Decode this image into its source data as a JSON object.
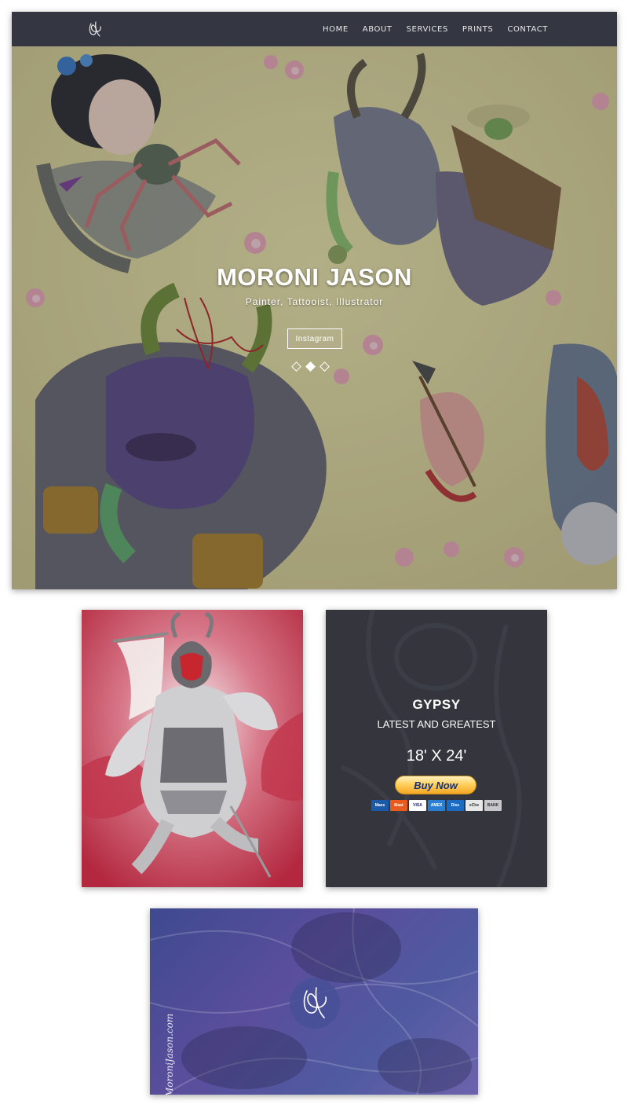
{
  "site": {
    "nav": {
      "logo_icon": "signature-logo-icon",
      "links": [
        "HOME",
        "ABOUT",
        "SERVICES",
        "PRINTS",
        "CONTACT"
      ]
    },
    "hero": {
      "title": "MORONI JASON",
      "subtitle": "Painter, Tattooist, Illustrator",
      "button_label": "Instagram",
      "slide_count": 3,
      "active_slide": 2
    }
  },
  "product": {
    "title": "GYPSY",
    "subtitle": "LATEST AND GREATEST",
    "size": "18' X 24'",
    "buy_label": "Buy Now",
    "payment_cards": [
      "Maestro",
      "MasterCard",
      "VISA",
      "AMEX",
      "Discover",
      "eCheck",
      "BANK"
    ]
  },
  "business_card": {
    "signature_text": "MoroniJason.com"
  },
  "colors": {
    "navbar": "#343741",
    "product_card_bg": "#34353d",
    "business_card_bg": "#4f5aa0",
    "print_red": "#c0344a",
    "paypal_yellow": "#ffd15e",
    "paypal_blue": "#13307a"
  }
}
